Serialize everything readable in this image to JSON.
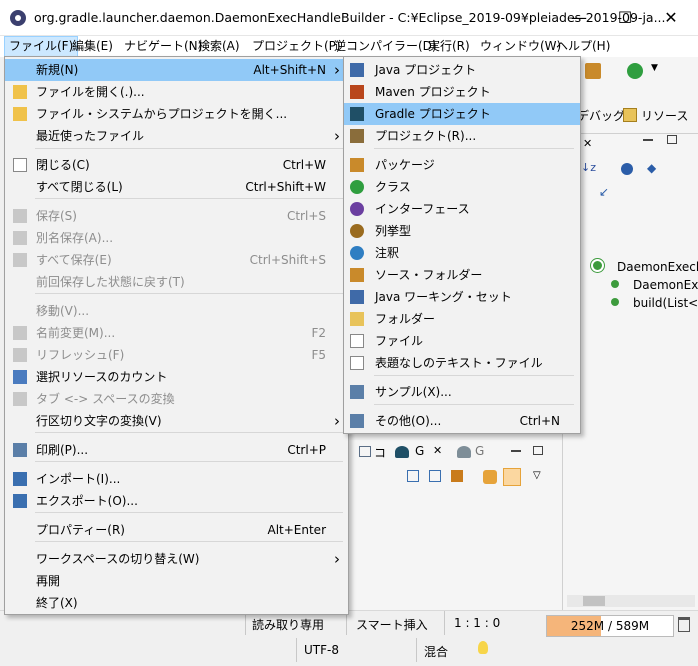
{
  "window": {
    "title": "org.gradle.launcher.daemon.DaemonExecHandleBuilder - C:¥Eclipse_2019-09¥pleiades-2019-09-ja...",
    "minimize": "—",
    "maximize": "☐",
    "close": "✕"
  },
  "menubar": [
    "ファイル(F)",
    "編集(E)",
    "ナビゲート(N)",
    "検索(A)",
    "プロジェクト(P)",
    "逆コンパイラー(D)",
    "実行(R)",
    "ウィンドウ(W)",
    "ヘルプ(H)"
  ],
  "file_menu": {
    "items": [
      {
        "label": "新規(N)",
        "shortcut": "Alt+Shift+N",
        "submenu": true,
        "highlighted": true
      },
      {
        "label": "ファイルを開く(.)..."
      },
      {
        "label": "ファイル・システムからプロジェクトを開く..."
      },
      {
        "label": "最近使ったファイル",
        "submenu": true
      },
      {
        "label": "閉じる(C)",
        "shortcut": "Ctrl+W"
      },
      {
        "label": "すべて閉じる(L)",
        "shortcut": "Ctrl+Shift+W"
      },
      {
        "label": "保存(S)",
        "shortcut": "Ctrl+S",
        "disabled": true
      },
      {
        "label": "別名保存(A)...",
        "disabled": true
      },
      {
        "label": "すべて保存(E)",
        "shortcut": "Ctrl+Shift+S",
        "disabled": true
      },
      {
        "label": "前回保存した状態に戻す(T)",
        "disabled": true
      },
      {
        "label": "移動(V)...",
        "disabled": true
      },
      {
        "label": "名前変更(M)...",
        "shortcut": "F2",
        "disabled": true
      },
      {
        "label": "リフレッシュ(F)",
        "shortcut": "F5",
        "disabled": true
      },
      {
        "label": "選択リソースのカウント"
      },
      {
        "label": "タブ <-> スペースの変換",
        "disabled": true
      },
      {
        "label": "行区切り文字の変換(V)",
        "submenu": true
      },
      {
        "label": "印刷(P)...",
        "shortcut": "Ctrl+P"
      },
      {
        "label": "インポート(I)..."
      },
      {
        "label": "エクスポート(O)..."
      },
      {
        "label": "プロパティー(R)",
        "shortcut": "Alt+Enter"
      },
      {
        "label": "ワークスペースの切り替え(W)",
        "submenu": true
      },
      {
        "label": "再開"
      },
      {
        "label": "終了(X)"
      }
    ]
  },
  "new_submenu": {
    "items": [
      {
        "label": "Java プロジェクト"
      },
      {
        "label": "Maven プロジェクト"
      },
      {
        "label": "Gradle プロジェクト",
        "highlighted": true
      },
      {
        "label": "プロジェクト(R)..."
      },
      {
        "label": "パッケージ"
      },
      {
        "label": "クラス"
      },
      {
        "label": "インターフェース"
      },
      {
        "label": "列挙型"
      },
      {
        "label": "注釈"
      },
      {
        "label": "ソース・フォルダー"
      },
      {
        "label": "Java ワーキング・セット"
      },
      {
        "label": "フォルダー"
      },
      {
        "label": "ファイル"
      },
      {
        "label": "表題なしのテキスト・ファイル"
      },
      {
        "label": "サンプル(X)..."
      },
      {
        "label": "その他(O)...",
        "shortcut": "Ctrl+N"
      }
    ]
  },
  "right_panel": {
    "toolbar_labels": [
      "デバッグ",
      "リソース"
    ],
    "tree": [
      "DaemonExech",
      "DaemonEx",
      "build(List<"
    ]
  },
  "bottom_tabs": [
    "コ",
    "G",
    "G"
  ],
  "statusbar": {
    "read_only": "読み取り専用",
    "smart_insert": "スマート挿入",
    "position": "1 : 1 : 0",
    "heap": "252M / 589M",
    "heap_fraction": 0.43,
    "encoding": "UTF-8",
    "mixed": "混合"
  },
  "colors": {
    "highlight": "#91c9f7",
    "menu_active": "#cce8ff",
    "heap_fill": "#f5b57a"
  }
}
